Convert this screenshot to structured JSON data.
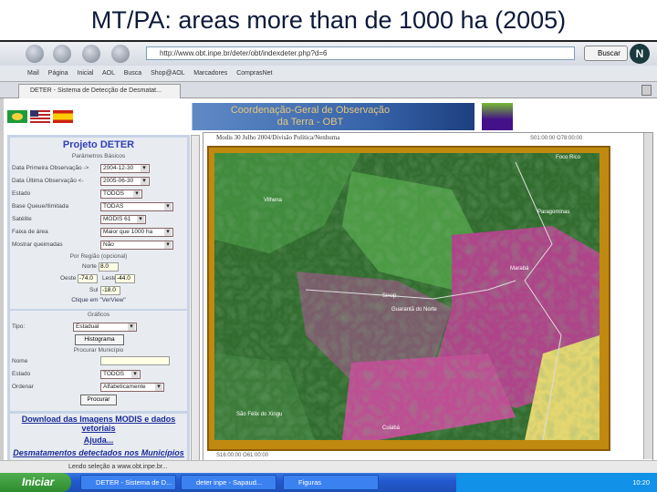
{
  "slide_title": "MT/PA: areas more than de 1000 ha (2005)",
  "browser": {
    "url": "http://www.obt.inpe.br/deter/obt/indexdeter.php?d=6",
    "search_label": "Buscar",
    "bookmarks": [
      "Mail",
      "Página Inicial",
      "AOL Busca",
      "Shop@AOL",
      "Marcadores",
      "ComprasNet"
    ],
    "tab_title": "DETER - Sistema de Detecção de Desmatat..."
  },
  "banner": {
    "line1": "Coordenação-Geral de Observação",
    "line2": "da Terra - OBT"
  },
  "form": {
    "title": "Projeto DETER",
    "section_basic": "Parâmetros Básicos",
    "fields": [
      {
        "label": "Data Primeira Observação ->",
        "value": "2004-12-30"
      },
      {
        "label": "Data Última Observação <-",
        "value": "2005-06-30"
      },
      {
        "label": "Estado",
        "value": "TODOS"
      },
      {
        "label": "Base Queue/Ilimitada",
        "value": "TODAS"
      },
      {
        "label": "Satélite",
        "value": "MODIS 61"
      },
      {
        "label": "Faixa de área",
        "value": "Maior que 1000 ha"
      },
      {
        "label": "Mostrar queimadas",
        "value": "Não"
      }
    ],
    "section_region": "Por Região (opcional)",
    "norte_label": "Norte",
    "norte": "8.0",
    "oeste_label": "Oeste",
    "oeste": "-74.0",
    "leste_label": "Leste",
    "leste": "-44.0",
    "sul_label": "Sul",
    "sul": "-18.0",
    "click_hint": "Clique em \"VerView\"",
    "section_graphs": "Gráficos",
    "tipo_label": "Tipo:",
    "tipo": "Estadual",
    "histogram_button": "Histograma",
    "section_municipio": "Procurar Município",
    "nome_label": "Nome",
    "estado_label": "Estado",
    "estado": "TODOS",
    "ordenar_label": "Ordenar",
    "ordenar": "Alfabeticamente",
    "search_button": "Procurar",
    "link_download": "Download das Imagens MODIS e dados vetoriais",
    "link_help": "Ajuda...",
    "link_municipios": "Desmatamentos detectados nos Municípios"
  },
  "map": {
    "caption": "Modis 30 Julho 2004/Divisão Política/Nenhuma",
    "coord_top": "S01:00:00 O78:00:00",
    "coord_bottom": "S16:00:00 O61:00:00",
    "labels": [
      "Foco Rico",
      "Paragominas",
      "Vilhena",
      "Sinop",
      "Guarantã do Norte",
      "Cuiabá",
      "São Félix do Xingu",
      "Marabá"
    ]
  },
  "status_text": "Lendo seleção a www.obt.inpe.br...",
  "taskbar": {
    "start": "Iniciar",
    "items": [
      "DETER - Sistema de D...",
      "deter inpe - Sapaud...",
      "Figuras"
    ],
    "clock": "10:20"
  }
}
